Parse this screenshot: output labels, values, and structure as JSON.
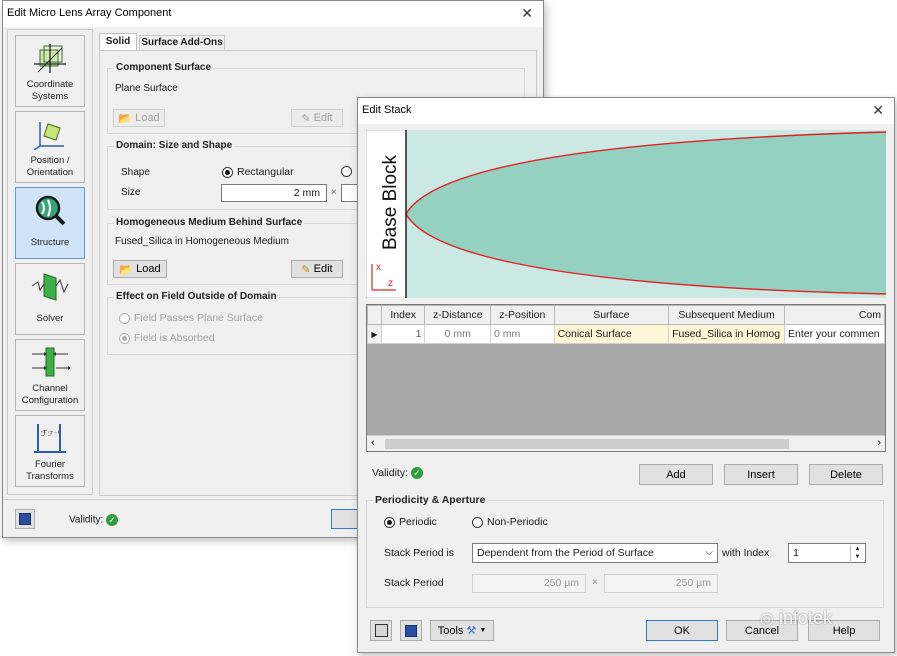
{
  "micro_lens_dialog": {
    "title": "Edit Micro Lens Array Component",
    "nav": [
      {
        "label": "Coordinate Systems"
      },
      {
        "label": "Position / Orientation"
      },
      {
        "label": "Structure"
      },
      {
        "label": "Solver"
      },
      {
        "label": "Channel Configuration"
      },
      {
        "label": "Fourier Transforms"
      }
    ],
    "tabs": [
      "Solid",
      "Surface Add-Ons"
    ],
    "component_surface": {
      "title": "Component Surface",
      "value": "Plane Surface",
      "load_label": "Load",
      "edit_label": "Edit"
    },
    "domain": {
      "title": "Domain: Size and Shape",
      "shape_label": "Shape",
      "rectangular_label": "Rectangular",
      "size_label": "Size",
      "size_value": "2 mm",
      "times": "×"
    },
    "medium": {
      "title": "Homogeneous Medium Behind Surface",
      "value": "Fused_Silica in Homogeneous Medium",
      "load_label": "Load",
      "edit_label": "Edit"
    },
    "effect": {
      "title": "Effect on Field Outside of Domain",
      "option1": "Field Passes Plane Surface",
      "option2": "Field is Absorbed"
    },
    "validity_label": "Validity:"
  },
  "edit_stack": {
    "title": "Edit Stack",
    "preview": {
      "label": "Base Block",
      "axis_x": "x",
      "axis_z": "z",
      "fill_color": "#94d1c0",
      "curve_color": "#e02020"
    },
    "table": {
      "columns": [
        "Index",
        "z-Distance",
        "z-Position",
        "Surface",
        "Subsequent Medium",
        "Com"
      ],
      "rows": [
        {
          "index": "1",
          "z_distance": "0 mm",
          "z_position": "0 mm",
          "surface": "Conical Surface",
          "medium": "Fused_Silica in Homog",
          "comment": "Enter your commen"
        }
      ]
    },
    "validity_label": "Validity:",
    "add_label": "Add",
    "insert_label": "Insert",
    "delete_label": "Delete",
    "periodicity": {
      "title": "Periodicity & Aperture",
      "periodic_label": "Periodic",
      "non_periodic_label": "Non-Periodic",
      "stack_period_is_label": "Stack Period is",
      "stack_period_select": "Dependent from the Period of Surface",
      "with_index_label": "with Index",
      "index_value": "1",
      "stack_period_label": "Stack Period",
      "period_x": "250 µm",
      "period_y": "250 µm",
      "times": "×"
    },
    "tools_label": "Tools",
    "ok_label": "OK",
    "cancel_label": "Cancel",
    "help_label": "Help",
    "watermark": "infotek"
  }
}
